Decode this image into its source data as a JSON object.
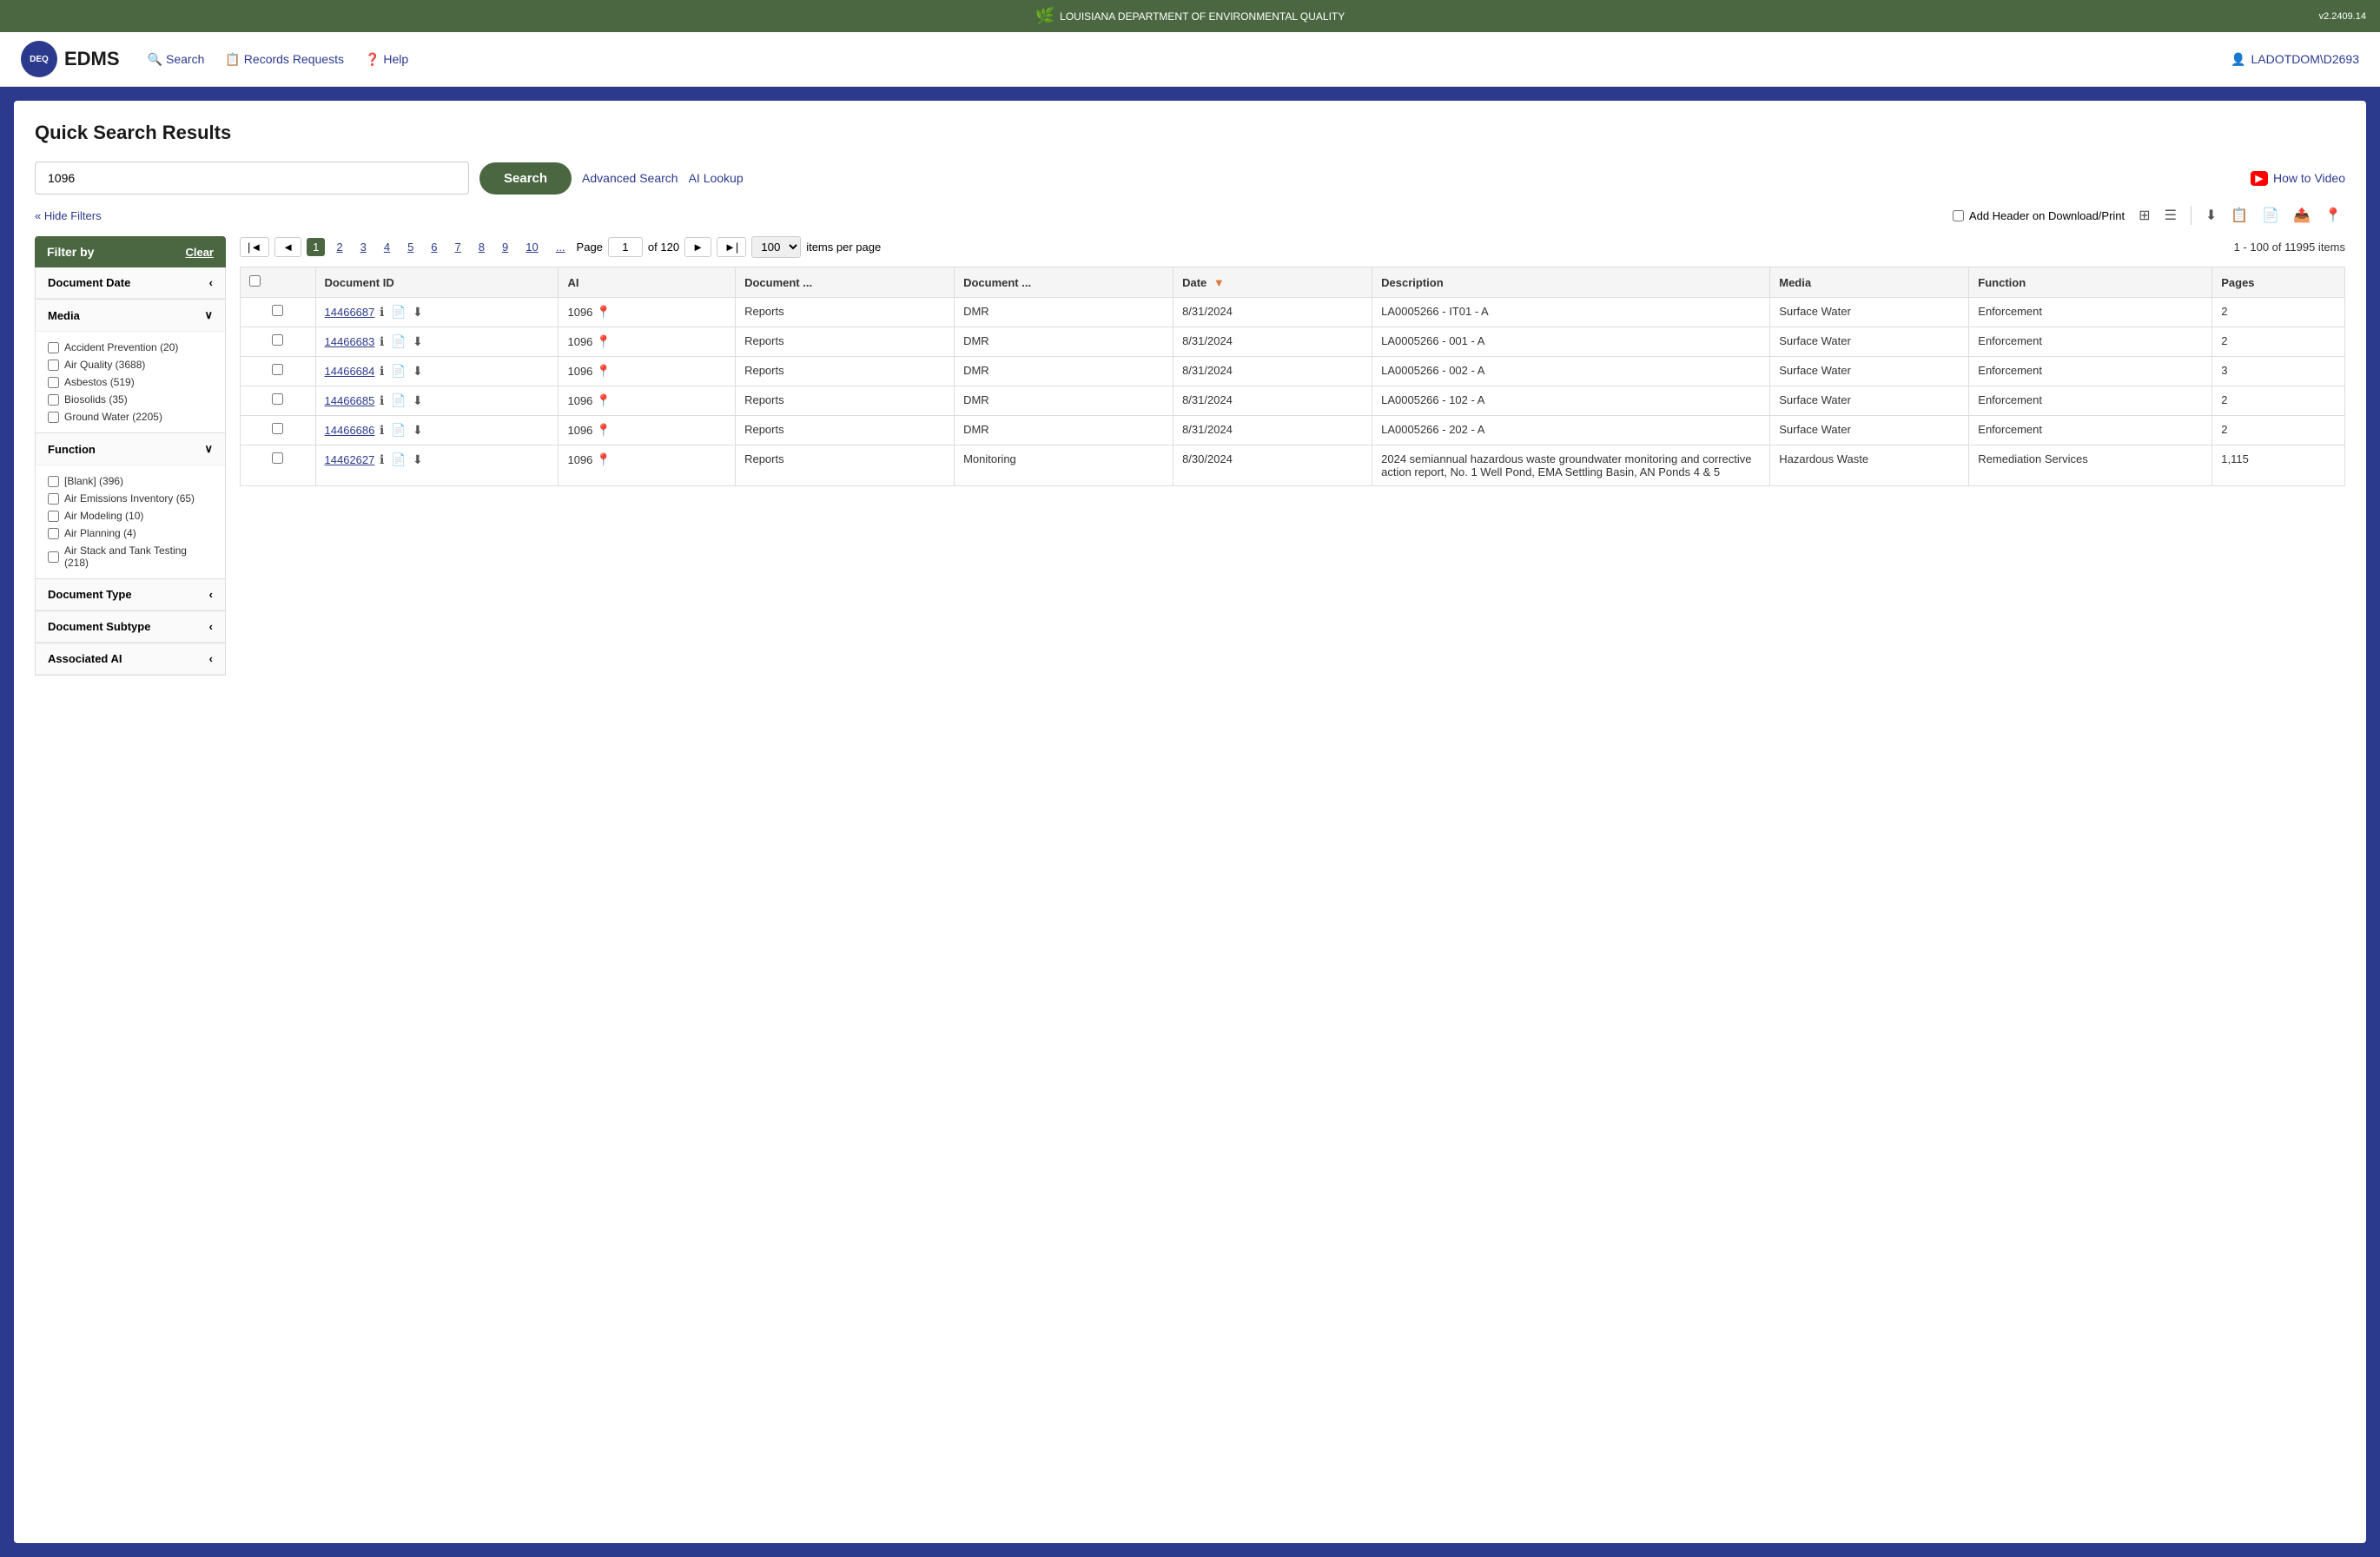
{
  "topBanner": {
    "text": "LOUISIANA DEPARTMENT OF ENVIRONMENTAL QUALITY",
    "version": "v2.2409.14",
    "logoAlt": "DEQ Logo"
  },
  "header": {
    "brand": "EDMS",
    "nav": [
      {
        "label": "Search",
        "icon": "🔍"
      },
      {
        "label": "Records Requests",
        "icon": "📋"
      },
      {
        "label": "Help",
        "icon": "❓"
      }
    ],
    "user": "LADOTDOM\\D2693"
  },
  "page": {
    "title": "Quick Search Results",
    "searchValue": "1096",
    "searchPlaceholder": "",
    "searchBtn": "Search",
    "advancedSearch": "Advanced Search",
    "aiLookup": "AI Lookup",
    "howToVideo": "How to Video",
    "hideFilters": "« Hide Filters",
    "addHeaderLabel": "Add Header on Download/Print"
  },
  "pagination": {
    "pages": [
      "1",
      "2",
      "3",
      "4",
      "5",
      "6",
      "7",
      "8",
      "9",
      "10",
      "..."
    ],
    "currentPage": "1",
    "pageLabel": "Page",
    "ofLabel": "of 120",
    "itemsPerPage": "100",
    "itemsPerPageLabel": "items per page",
    "resultsCount": "1 - 100 of 11995 items"
  },
  "filters": {
    "header": "Filter by",
    "clearLabel": "Clear",
    "sections": [
      {
        "name": "Document Date",
        "expanded": false,
        "items": []
      },
      {
        "name": "Media",
        "expanded": true,
        "items": [
          "Accident Prevention (20)",
          "Air Quality (3688)",
          "Asbestos (519)",
          "Biosolids (35)",
          "Ground Water (2205)"
        ]
      },
      {
        "name": "Function",
        "expanded": true,
        "items": [
          "[Blank] (396)",
          "Air Emissions Inventory (65)",
          "Air Modeling (10)",
          "Air Planning (4)",
          "Air Stack and Tank Testing (218)"
        ]
      },
      {
        "name": "Document Type",
        "expanded": false,
        "items": []
      },
      {
        "name": "Document Subtype",
        "expanded": false,
        "items": []
      },
      {
        "name": "Associated AI",
        "expanded": false,
        "items": []
      }
    ]
  },
  "table": {
    "columns": [
      {
        "key": "checkbox",
        "label": ""
      },
      {
        "key": "documentId",
        "label": "Document ID"
      },
      {
        "key": "ai",
        "label": "AI"
      },
      {
        "key": "documentType",
        "label": "Document ..."
      },
      {
        "key": "documentSubtype",
        "label": "Document ..."
      },
      {
        "key": "date",
        "label": "Date",
        "sort": "desc"
      },
      {
        "key": "description",
        "label": "Description"
      },
      {
        "key": "media",
        "label": "Media"
      },
      {
        "key": "function",
        "label": "Function"
      },
      {
        "key": "pages",
        "label": "Pages"
      }
    ],
    "rows": [
      {
        "documentId": "14466687",
        "ai": "1096",
        "documentType": "Reports",
        "documentSubtype": "DMR",
        "date": "8/31/2024",
        "description": "LA0005266 - IT01 - A",
        "media": "Surface Water",
        "function": "Enforcement",
        "pages": "2"
      },
      {
        "documentId": "14466683",
        "ai": "1096",
        "documentType": "Reports",
        "documentSubtype": "DMR",
        "date": "8/31/2024",
        "description": "LA0005266 - 001 - A",
        "media": "Surface Water",
        "function": "Enforcement",
        "pages": "2"
      },
      {
        "documentId": "14466684",
        "ai": "1096",
        "documentType": "Reports",
        "documentSubtype": "DMR",
        "date": "8/31/2024",
        "description": "LA0005266 - 002 - A",
        "media": "Surface Water",
        "function": "Enforcement",
        "pages": "3"
      },
      {
        "documentId": "14466685",
        "ai": "1096",
        "documentType": "Reports",
        "documentSubtype": "DMR",
        "date": "8/31/2024",
        "description": "LA0005266 - 102 - A",
        "media": "Surface Water",
        "function": "Enforcement",
        "pages": "2"
      },
      {
        "documentId": "14466686",
        "ai": "1096",
        "documentType": "Reports",
        "documentSubtype": "DMR",
        "date": "8/31/2024",
        "description": "LA0005266 - 202 - A",
        "media": "Surface Water",
        "function": "Enforcement",
        "pages": "2"
      },
      {
        "documentId": "14462627",
        "ai": "1096",
        "documentType": "Reports",
        "documentSubtype": "Monitoring",
        "date": "8/30/2024",
        "description": "2024 semiannual hazardous waste groundwater monitoring and corrective action report, No. 1 Well Pond, EMA Settling Basin, AN Ponds 4 & 5",
        "media": "Hazardous Waste",
        "function": "Remediation Services",
        "pages": "1,115"
      }
    ]
  }
}
